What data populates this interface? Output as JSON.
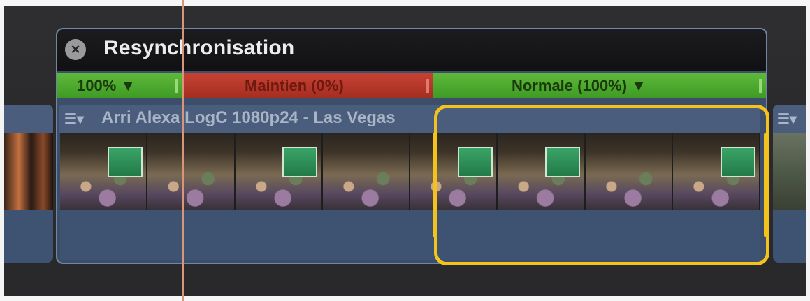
{
  "retime": {
    "title": "Resynchronisation",
    "close_glyph": "×"
  },
  "segments": [
    {
      "label": "100% ▼",
      "color": "#4da82e"
    },
    {
      "label": "Maintien (0%)",
      "color": "#b3382a"
    },
    {
      "label": "Normale (100%) ▼",
      "color": "#4da82e"
    }
  ],
  "clip": {
    "icon": "clip-retime-menu-icon",
    "icon_glyph": "☰▾",
    "title": "Arri Alexa LogC 1080p24 - Las Vegas"
  },
  "neighbor_clip": {
    "icon": "clip-retime-menu-icon",
    "icon_glyph": "☰▾"
  },
  "colors": {
    "selection": "#f4c21c",
    "playhead": "#d9957a",
    "clip_blue": "#3e5272"
  }
}
